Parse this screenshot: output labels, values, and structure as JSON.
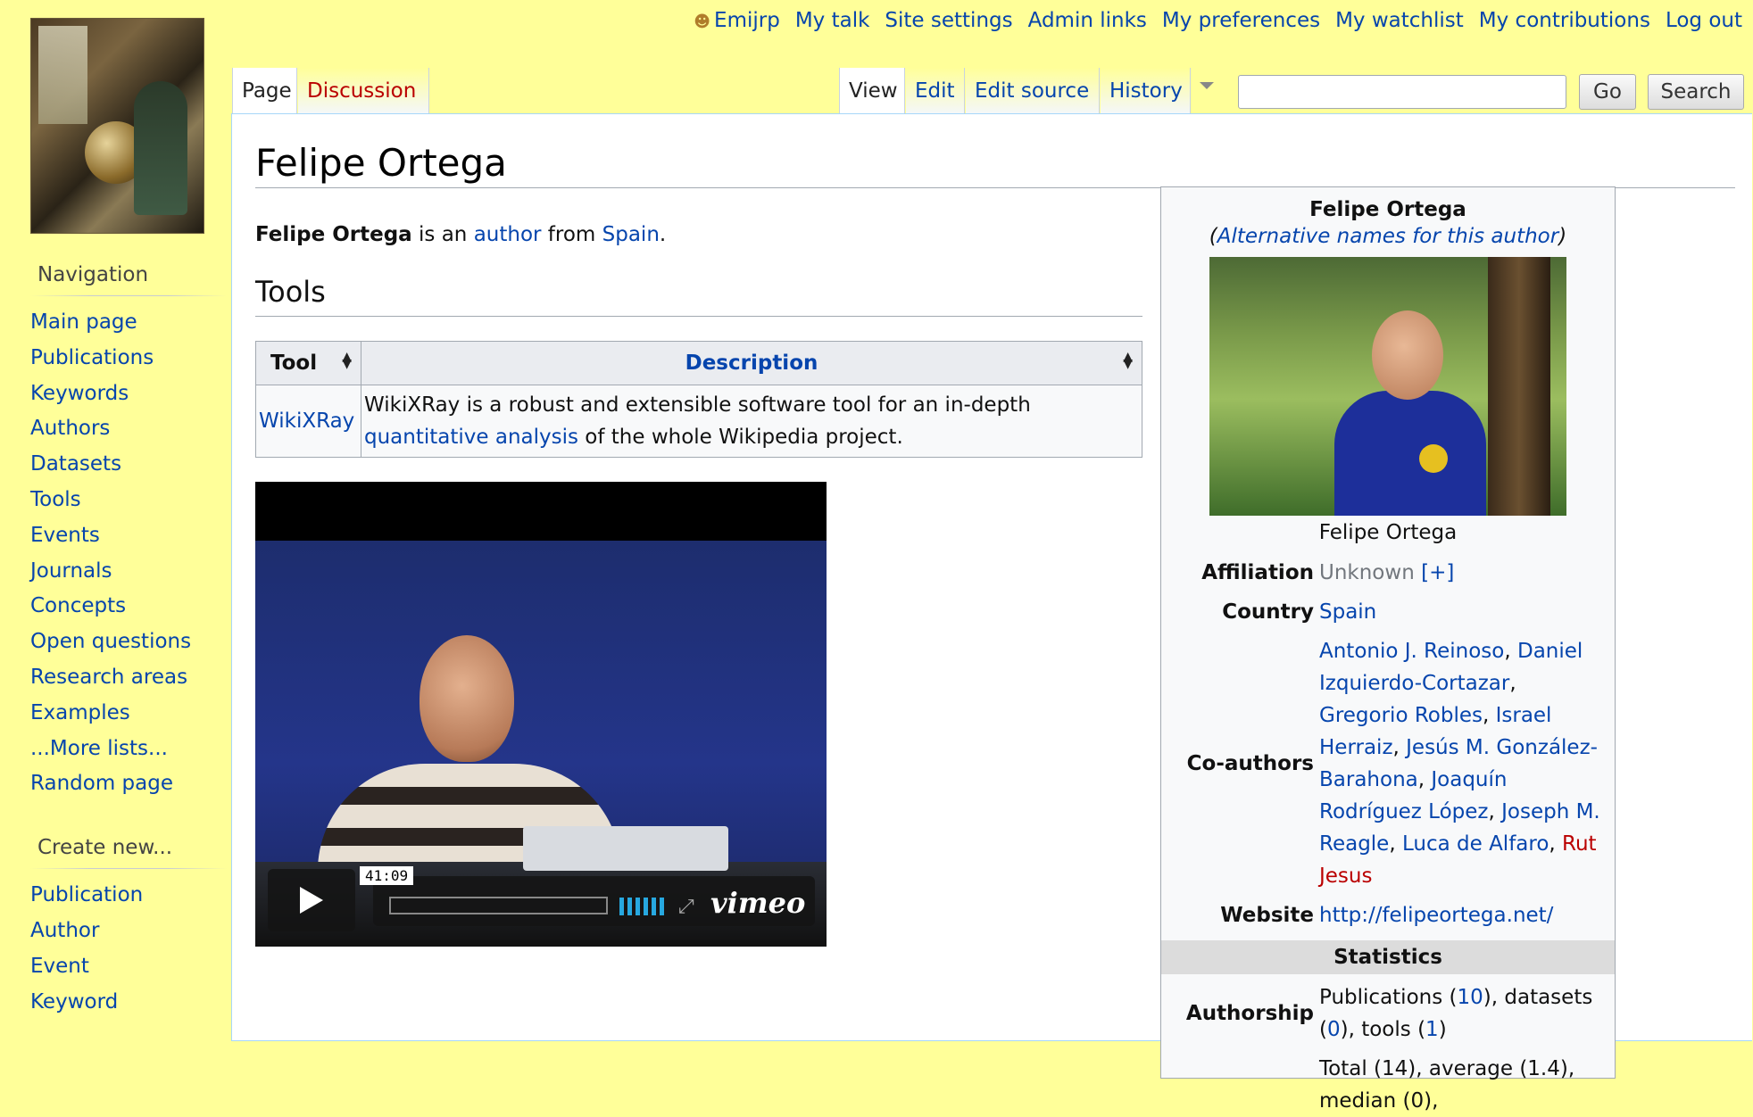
{
  "personal": {
    "user": "Emijrp",
    "links": [
      "My talk",
      "Site settings",
      "Admin links",
      "My preferences",
      "My watchlist",
      "My contributions",
      "Log out"
    ]
  },
  "sidebar": {
    "navigation_heading": "Navigation",
    "navigation_items": [
      "Main page",
      "Publications",
      "Keywords",
      "Authors",
      "Datasets",
      "Tools",
      "Events",
      "Journals",
      "Concepts",
      "Open questions",
      "Research areas",
      "Examples",
      "...More lists...",
      "Random page"
    ],
    "create_heading": "Create new...",
    "create_items": [
      "Publication",
      "Author",
      "Event",
      "Keyword"
    ]
  },
  "tabs": {
    "page": "Page",
    "discussion": "Discussion",
    "view": "View",
    "edit": "Edit",
    "edit_source": "Edit source",
    "history": "History"
  },
  "search": {
    "value": "",
    "go_label": "Go",
    "search_label": "Search"
  },
  "page": {
    "title": "Felipe Ortega",
    "intro": {
      "name": "Felipe Ortega",
      "t1": " is an ",
      "link1": "author",
      "t2": " from ",
      "link2": "Spain",
      "t3": "."
    },
    "tools_heading": "Tools",
    "tools_table": {
      "headers": [
        "Tool",
        "Description"
      ],
      "rows": [
        {
          "tool": "WikiXRay",
          "desc1": "WikiXRay is a robust and extensible software tool for an in-depth ",
          "desc_link": "quantitative analysis",
          "desc2": " of the whole Wikipedia project."
        }
      ]
    },
    "video": {
      "timecode": "41:09",
      "brand": "vimeo"
    }
  },
  "infobox": {
    "title": "Felipe Ortega",
    "alt_names": "Alternative names for this author",
    "caption": "Felipe Ortega",
    "affiliation_label": "Affiliation",
    "affiliation_value": "Unknown",
    "affiliation_add": "[+]",
    "country_label": "Country",
    "country_value": "Spain",
    "coauthors_label": "Co-authors",
    "coauthors": [
      {
        "name": "Antonio J. Reinoso",
        "exists": true
      },
      {
        "name": "Daniel Izquierdo-Cortazar",
        "exists": true
      },
      {
        "name": "Gregorio Robles",
        "exists": true
      },
      {
        "name": "Israel Herraiz",
        "exists": true
      },
      {
        "name": "Jesús M. González-Barahona",
        "exists": true
      },
      {
        "name": "Joaquín Rodríguez López",
        "exists": true
      },
      {
        "name": "Joseph M. Reagle",
        "exists": true
      },
      {
        "name": "Luca de Alfaro",
        "exists": true
      },
      {
        "name": "Rut Jesus",
        "exists": false
      }
    ],
    "website_label": "Website",
    "website_value": "http://felipeortega.net/",
    "statistics_heading": "Statistics",
    "authorship_label": "Authorship",
    "authorship": {
      "pub_text": "Publications (",
      "pub_count": "10",
      "ds_text": "), datasets (",
      "ds_count": "0",
      "tools_text": "), tools (",
      "tools_count": "1",
      "end": ")"
    },
    "citations_value": "Total (14), average (1.4), median (0),"
  },
  "colors": {
    "background": "#ffff99",
    "link": "#0645ad",
    "new_link": "#ba0000"
  }
}
